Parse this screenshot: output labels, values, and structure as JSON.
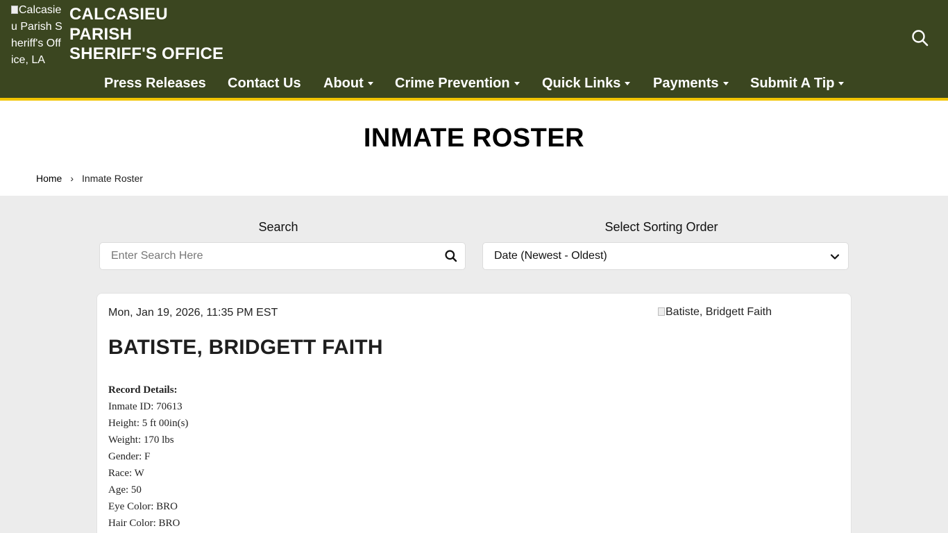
{
  "header": {
    "logo_alt": "Calcasieu Parish Sheriff's Office, LA",
    "title_lines": [
      "CALCASIEU",
      "PARISH",
      "SHERIFF'S OFFICE"
    ],
    "background": "#3b4620",
    "accent_stripe": "#f2c500",
    "search_icon": "search-icon"
  },
  "nav": {
    "items": [
      {
        "label": "Press Releases",
        "dropdown": false
      },
      {
        "label": "Contact Us",
        "dropdown": false
      },
      {
        "label": "About",
        "dropdown": true
      },
      {
        "label": "Crime Prevention",
        "dropdown": true
      },
      {
        "label": "Quick Links",
        "dropdown": true
      },
      {
        "label": "Payments",
        "dropdown": true
      },
      {
        "label": "Submit A Tip",
        "dropdown": true
      }
    ]
  },
  "page": {
    "title": "INMATE ROSTER",
    "breadcrumb": {
      "home": "Home",
      "separator": "›",
      "current": "Inmate Roster"
    }
  },
  "filters": {
    "search_label": "Search",
    "search_placeholder": "Enter Search Here",
    "search_value": "",
    "sort_label": "Select Sorting Order",
    "sort_value": "Date (Newest - Oldest)"
  },
  "record": {
    "date": "Mon, Jan 19, 2026, 11:35 PM EST",
    "photo_alt": "Batiste, Bridgett Faith",
    "name": "BATISTE, BRIDGETT FAITH",
    "details_heading": "Record Details:",
    "details": [
      "Inmate ID: 70613",
      "Height: 5 ft 00in(s)",
      "Weight: 170 lbs",
      "Gender: F",
      "Race: W",
      "Age: 50",
      "Eye Color: BRO",
      "Hair Color: BRO"
    ]
  }
}
